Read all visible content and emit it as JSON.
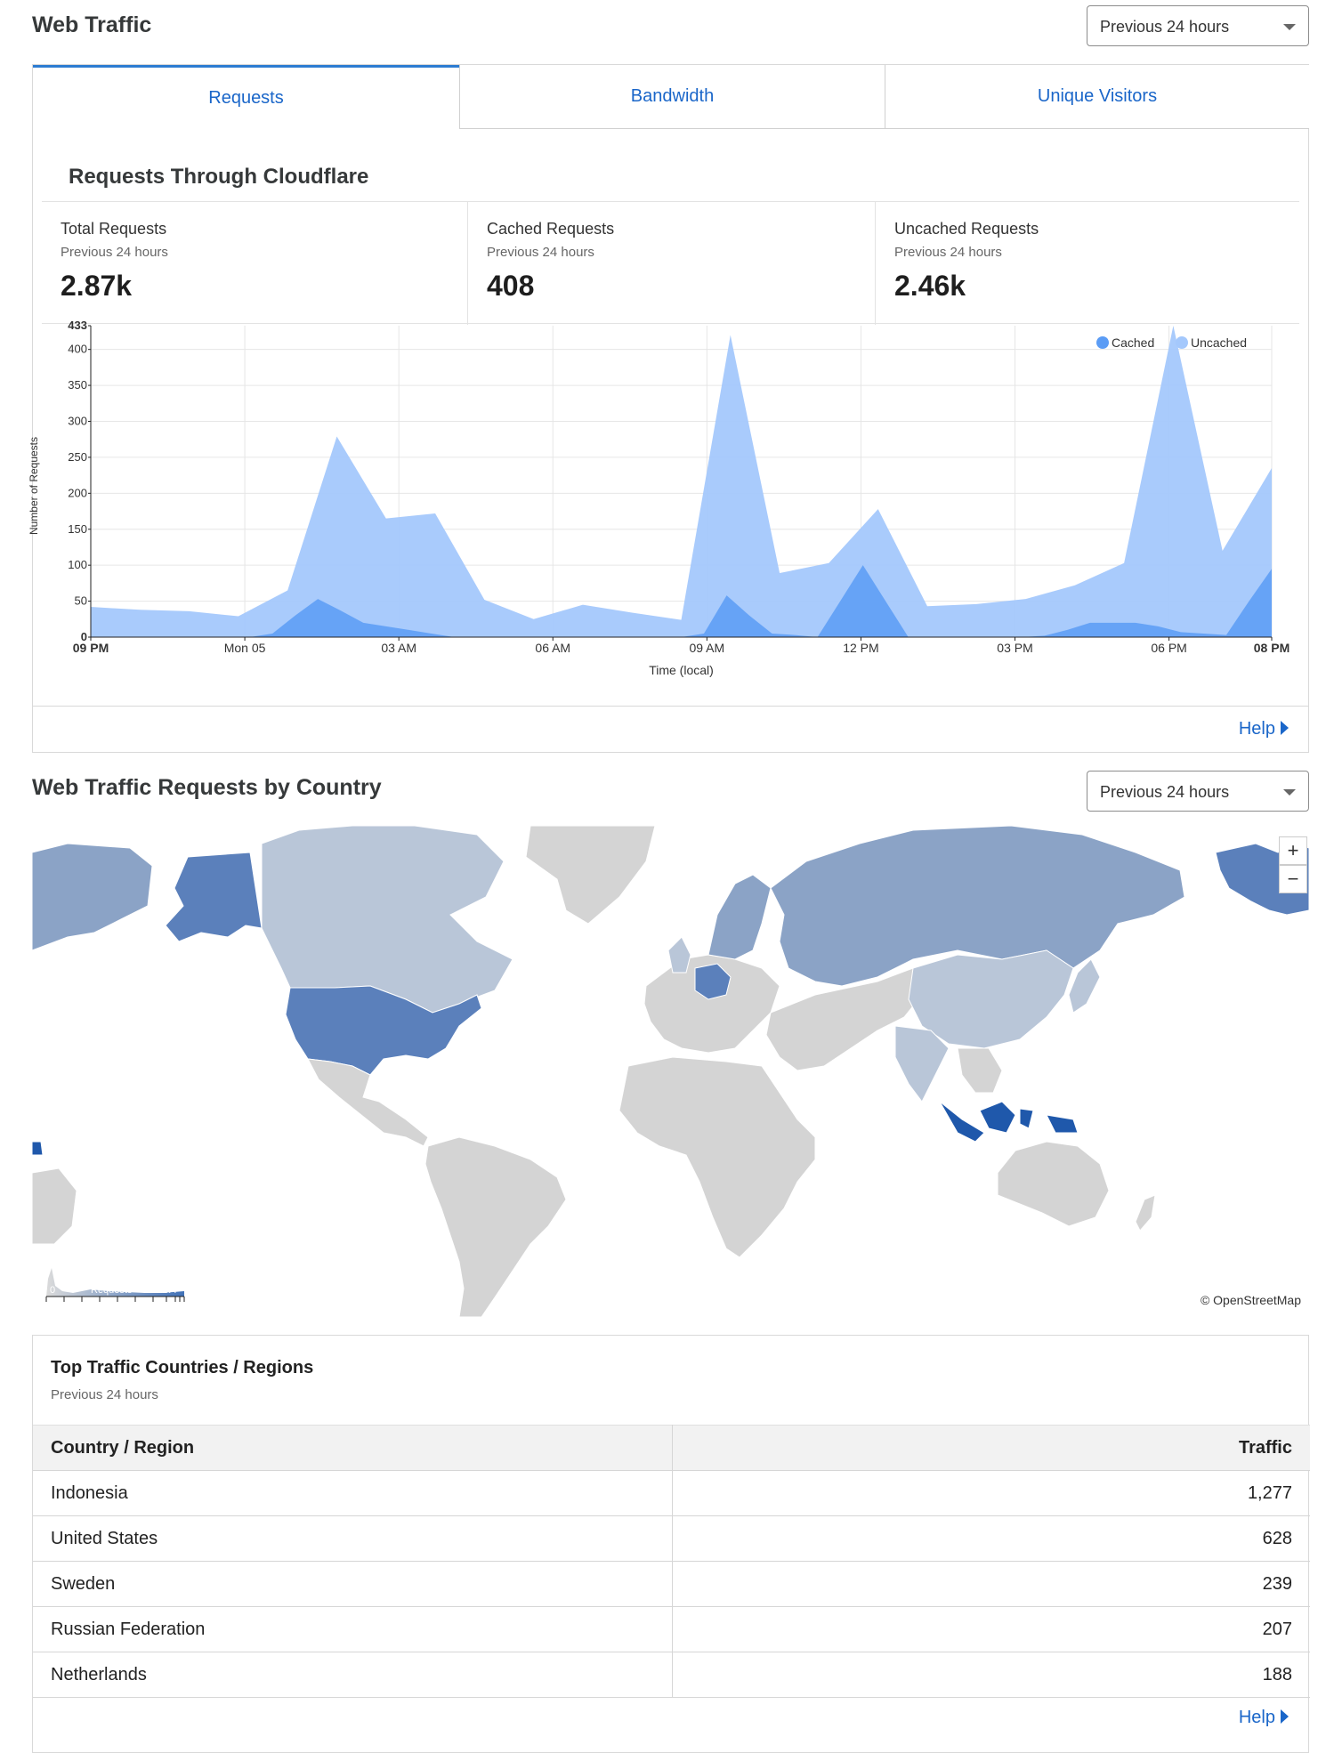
{
  "header": {
    "title": "Web Traffic",
    "range": "Previous 24 hours"
  },
  "tabs": [
    {
      "label": "Requests"
    },
    {
      "label": "Bandwidth"
    },
    {
      "label": "Unique Visitors"
    }
  ],
  "requests_card": {
    "title": "Requests Through Cloudflare",
    "stats": [
      {
        "label": "Total Requests",
        "sub": "Previous 24 hours",
        "value": "2.87k"
      },
      {
        "label": "Cached Requests",
        "sub": "Previous 24 hours",
        "value": "408"
      },
      {
        "label": "Uncached Requests",
        "sub": "Previous 24 hours",
        "value": "2.46k"
      }
    ],
    "help": "Help"
  },
  "chart_data": {
    "type": "area",
    "xlabel": "Time (local)",
    "ylabel": "Number of Requests",
    "ylim": [
      0,
      433
    ],
    "yticks": [
      0,
      50,
      100,
      150,
      200,
      250,
      300,
      350,
      400,
      433
    ],
    "x_tick_labels": [
      "09 PM",
      "Mon 05",
      "03 AM",
      "06 AM",
      "09 AM",
      "12 PM",
      "03 PM",
      "06 PM",
      "08 PM"
    ],
    "x_tick_hours": [
      0,
      3,
      6,
      9,
      12,
      15,
      18,
      21,
      23
    ],
    "grid": true,
    "legend_position": "top-right",
    "x_hours": [
      0,
      0.5,
      1,
      1.5,
      2,
      2.5,
      3,
      3.5,
      4,
      4.5,
      5,
      5.5,
      6,
      6.5,
      7,
      7.5,
      8,
      8.5,
      9,
      9.5,
      10,
      10.5,
      11,
      11.5,
      12,
      12.5,
      13,
      13.5,
      14,
      14.5,
      15,
      15.5,
      16,
      16.5,
      17,
      17.5,
      18,
      18.5,
      19,
      19.5,
      20,
      20.5,
      21,
      21.5,
      22,
      22.5,
      23
    ],
    "series": [
      {
        "name": "Cached",
        "color": "#5b9cf5",
        "values": [
          0,
          0,
          0,
          0,
          0,
          0,
          0,
          0,
          5,
          30,
          53,
          37,
          20,
          15,
          10,
          5,
          0,
          0,
          0,
          0,
          0,
          0,
          0,
          0,
          0,
          0,
          0,
          5,
          58,
          30,
          5,
          3,
          0,
          50,
          100,
          50,
          0,
          0,
          0,
          0,
          0,
          0,
          2,
          10,
          20,
          20,
          20,
          15,
          7,
          5,
          3,
          50,
          95
        ]
      },
      {
        "name": "Uncached",
        "color": "#a4c8fc",
        "values": [
          42,
          38,
          36,
          29,
          65,
          279,
          165,
          172,
          52,
          25,
          45,
          34,
          24,
          420,
          89,
          103,
          178,
          43,
          46,
          53,
          72,
          103,
          433,
          120,
          235
        ]
      }
    ],
    "stacked_values": [
      42,
      38,
      36,
      29,
      65,
      279,
      165,
      172,
      52,
      25,
      45,
      34,
      24,
      420,
      89,
      103,
      178,
      43,
      46,
      53,
      72,
      103,
      433,
      120,
      235
    ]
  },
  "map_section": {
    "title": "Web Traffic Requests by Country",
    "range": "Previous 24 hours",
    "zoom_in": "+",
    "zoom_out": "−",
    "attribution": "© OpenStreetMap",
    "legend_min": "0",
    "legend_label": "Requests",
    "legend_max": "1277",
    "colors": {
      "none": "#d4d4d4",
      "low": "#b9c6d8",
      "mid": "#8ba3c6",
      "high": "#5b80bb",
      "top": "#1f58ab"
    }
  },
  "top_countries": {
    "title": "Top Traffic Countries / Regions",
    "sub": "Previous 24 hours",
    "columns": [
      "Country / Region",
      "Traffic"
    ],
    "rows": [
      {
        "country": "Indonesia",
        "traffic": "1,277"
      },
      {
        "country": "United States",
        "traffic": "628"
      },
      {
        "country": "Sweden",
        "traffic": "239"
      },
      {
        "country": "Russian Federation",
        "traffic": "207"
      },
      {
        "country": "Netherlands",
        "traffic": "188"
      }
    ],
    "help": "Help"
  }
}
